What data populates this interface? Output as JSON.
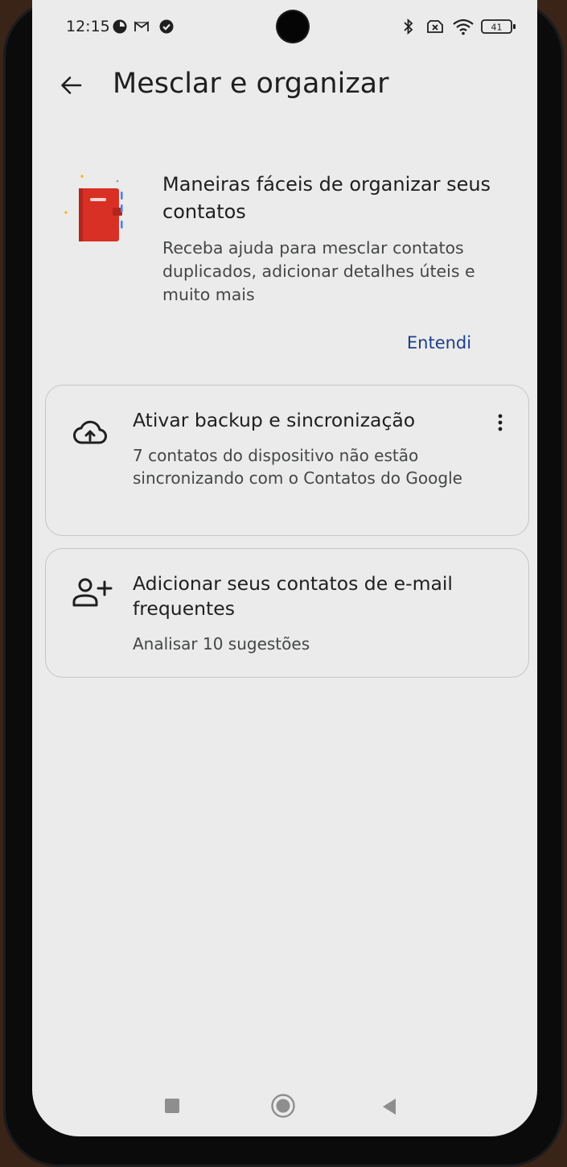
{
  "status_bar": {
    "time": "12:15",
    "battery": "41",
    "icons": [
      "data-saver-icon",
      "gmail-icon",
      "check-circle-icon",
      "bluetooth-icon",
      "no-sim-icon",
      "wifi-icon",
      "battery-icon"
    ]
  },
  "app_bar": {
    "title": "Mesclar e organizar",
    "back_icon": "arrow-back-icon"
  },
  "promo": {
    "title": "Maneiras fáceis de organizar seus contatos",
    "body": "Receba ajuda para mesclar contatos duplicados, adicionar detalhes úteis e muito mais",
    "action": "Entendi",
    "illustration": "contact-book-illustration"
  },
  "cards": {
    "backup": {
      "icon": "cloud-upload-icon",
      "title": "Ativar backup e sincronização",
      "subtitle": "7 contatos do dispositivo não estão sincronizando com o Contatos do Google",
      "menu_icon": "more-vert-icon"
    },
    "suggestions": {
      "icon": "person-add-icon",
      "title": "Adicionar seus contatos de e-mail frequentes",
      "subtitle": "Analisar 10 sugestões"
    }
  },
  "nav_bar": {
    "icons": [
      "recents-square-icon",
      "home-circle-icon",
      "back-triangle-icon"
    ]
  },
  "colors": {
    "screen_bg": "#eaebea",
    "accent_text": "#1f3e8a",
    "illustration_red": "#d93025",
    "card_border": "#c4c7c5"
  }
}
